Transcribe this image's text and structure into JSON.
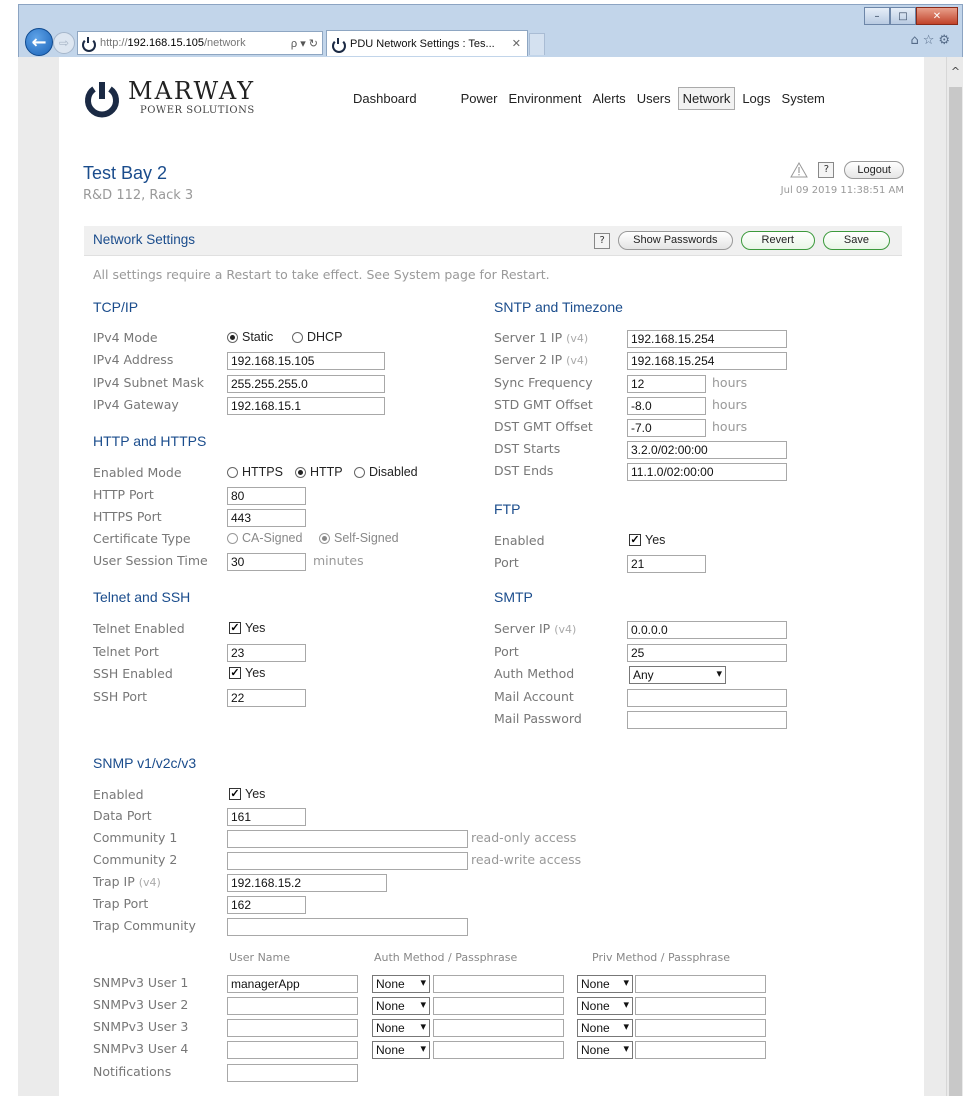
{
  "browser": {
    "address_prefix": "http://",
    "address_host": "192.168.15.105",
    "address_path": "/network",
    "address_tools": "ρ ▾ ↻",
    "tab_title": "PDU Network Settings : Tes...",
    "tab_close": "✕",
    "back_glyph": "←",
    "forward_glyph": "⇨",
    "icons": "⌂☆⚙",
    "window_controls": {
      "minimize": "–",
      "maximize": "□",
      "close": "✕"
    }
  },
  "header": {
    "logo_name": "MARWAY",
    "logo_sub": "POWER SOLUTIONS",
    "nav": [
      "Dashboard",
      "Power",
      "Environment",
      "Alerts",
      "Users",
      "Network",
      "Logs",
      "System"
    ],
    "active_nav": "Network"
  },
  "device": {
    "name": "Test Bay 2",
    "location": "R&D 112, Rack 3",
    "help": "?",
    "logout": "Logout",
    "timestamp": "Jul 09 2019 11:38:51 AM"
  },
  "panel": {
    "title": "Network Settings",
    "help": "?",
    "show_passwords": "Show Passwords",
    "revert": "Revert",
    "save": "Save",
    "note": "All settings require a Restart to take effect. See System page for Restart."
  },
  "tcpip": {
    "title": "TCP/IP",
    "mode_label": "IPv4 Mode",
    "mode_options": [
      "Static",
      "DHCP"
    ],
    "mode_selected": "Static",
    "address_label": "IPv4 Address",
    "address": "192.168.15.105",
    "mask_label": "IPv4 Subnet Mask",
    "mask": "255.255.255.0",
    "gateway_label": "IPv4 Gateway",
    "gateway": "192.168.15.1"
  },
  "http": {
    "title": "HTTP and HTTPS",
    "mode_label": "Enabled Mode",
    "mode_options": [
      "HTTPS",
      "HTTP",
      "Disabled"
    ],
    "mode_selected": "HTTP",
    "http_port_label": "HTTP Port",
    "http_port": "80",
    "https_port_label": "HTTPS Port",
    "https_port": "443",
    "cert_label": "Certificate Type",
    "cert_options": [
      "CA-Signed",
      "Self-Signed"
    ],
    "cert_selected": "Self-Signed",
    "session_label": "User Session Time",
    "session": "30",
    "session_unit": "minutes"
  },
  "telnet": {
    "title": "Telnet and SSH",
    "telnet_enabled_label": "Telnet Enabled",
    "telnet_enabled": "Yes",
    "telnet_port_label": "Telnet Port",
    "telnet_port": "23",
    "ssh_enabled_label": "SSH Enabled",
    "ssh_enabled": "Yes",
    "ssh_port_label": "SSH Port",
    "ssh_port": "22"
  },
  "sntp": {
    "title": "SNTP and Timezone",
    "v4": "(v4)",
    "server1_label": "Server 1 IP",
    "server1": "192.168.15.254",
    "server2_label": "Server 2 IP",
    "server2": "192.168.15.254",
    "sync_label": "Sync Frequency",
    "sync": "12",
    "std_label": "STD GMT Offset",
    "std": "-8.0",
    "dst_label": "DST GMT Offset",
    "dst": "-7.0",
    "hours": "hours",
    "dst_starts_label": "DST Starts",
    "dst_starts": "3.2.0/02:00:00",
    "dst_ends_label": "DST Ends",
    "dst_ends": "11.1.0/02:00:00"
  },
  "ftp": {
    "title": "FTP",
    "enabled_label": "Enabled",
    "enabled": "Yes",
    "port_label": "Port",
    "port": "21"
  },
  "smtp": {
    "title": "SMTP",
    "server_label": "Server IP",
    "v4": "(v4)",
    "server": "0.0.0.0",
    "port_label": "Port",
    "port": "25",
    "auth_label": "Auth Method",
    "auth": "Any",
    "account_label": "Mail Account",
    "account": "",
    "password_label": "Mail Password",
    "password": ""
  },
  "snmp": {
    "title": "SNMP v1/v2c/v3",
    "enabled_label": "Enabled",
    "enabled": "Yes",
    "data_port_label": "Data Port",
    "data_port": "161",
    "community1_label": "Community 1",
    "community1": "",
    "community1_note": "read-only access",
    "community2_label": "Community 2",
    "community2": "",
    "community2_note": "read-write access",
    "trap_ip_label": "Trap IP",
    "v4": "(v4)",
    "trap_ip": "192.168.15.2",
    "trap_port_label": "Trap Port",
    "trap_port": "162",
    "trap_community_label": "Trap Community",
    "trap_community": "",
    "col_user": "User Name",
    "col_auth": "Auth Method / Passphrase",
    "col_priv": "Priv Method / Passphrase",
    "users": [
      {
        "label": "SNMPv3 User 1",
        "name": "managerApp",
        "auth": "None",
        "priv": "None"
      },
      {
        "label": "SNMPv3 User 2",
        "name": "",
        "auth": "None",
        "priv": "None"
      },
      {
        "label": "SNMPv3 User 3",
        "name": "",
        "auth": "None",
        "priv": "None"
      },
      {
        "label": "SNMPv3 User 4",
        "name": "",
        "auth": "None",
        "priv": "None"
      }
    ],
    "notifications_label": "Notifications",
    "notifications": ""
  },
  "colors": {
    "accent_blue": "#1a4c8c",
    "label_gray": "#777777",
    "save_green": "#3c9a3c",
    "chrome_blue": "#c2d5ea"
  },
  "icons": {
    "back": "back-arrow-icon",
    "forward": "forward-arrow-icon",
    "warning": "warning-triangle-icon",
    "help": "help-icon",
    "dropdown": "chevron-down-icon"
  }
}
